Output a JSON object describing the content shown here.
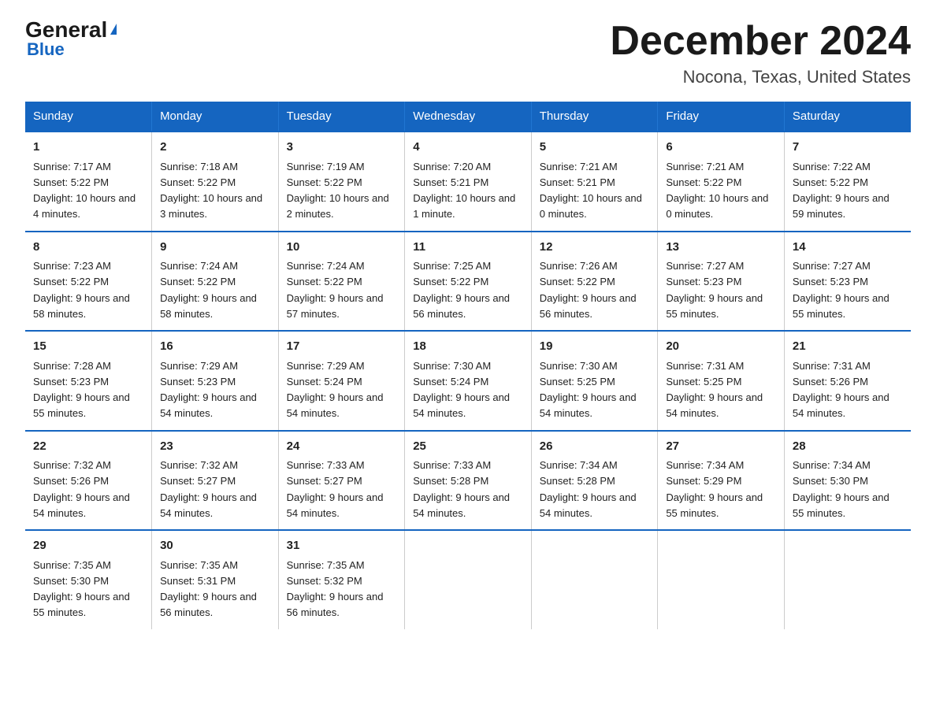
{
  "logo": {
    "general": "General",
    "triangle": "▲",
    "blue": "Blue"
  },
  "title": "December 2024",
  "subtitle": "Nocona, Texas, United States",
  "days_of_week": [
    "Sunday",
    "Monday",
    "Tuesday",
    "Wednesday",
    "Thursday",
    "Friday",
    "Saturday"
  ],
  "weeks": [
    [
      {
        "day": "1",
        "sunrise": "7:17 AM",
        "sunset": "5:22 PM",
        "daylight": "10 hours and 4 minutes."
      },
      {
        "day": "2",
        "sunrise": "7:18 AM",
        "sunset": "5:22 PM",
        "daylight": "10 hours and 3 minutes."
      },
      {
        "day": "3",
        "sunrise": "7:19 AM",
        "sunset": "5:22 PM",
        "daylight": "10 hours and 2 minutes."
      },
      {
        "day": "4",
        "sunrise": "7:20 AM",
        "sunset": "5:21 PM",
        "daylight": "10 hours and 1 minute."
      },
      {
        "day": "5",
        "sunrise": "7:21 AM",
        "sunset": "5:21 PM",
        "daylight": "10 hours and 0 minutes."
      },
      {
        "day": "6",
        "sunrise": "7:21 AM",
        "sunset": "5:22 PM",
        "daylight": "10 hours and 0 minutes."
      },
      {
        "day": "7",
        "sunrise": "7:22 AM",
        "sunset": "5:22 PM",
        "daylight": "9 hours and 59 minutes."
      }
    ],
    [
      {
        "day": "8",
        "sunrise": "7:23 AM",
        "sunset": "5:22 PM",
        "daylight": "9 hours and 58 minutes."
      },
      {
        "day": "9",
        "sunrise": "7:24 AM",
        "sunset": "5:22 PM",
        "daylight": "9 hours and 58 minutes."
      },
      {
        "day": "10",
        "sunrise": "7:24 AM",
        "sunset": "5:22 PM",
        "daylight": "9 hours and 57 minutes."
      },
      {
        "day": "11",
        "sunrise": "7:25 AM",
        "sunset": "5:22 PM",
        "daylight": "9 hours and 56 minutes."
      },
      {
        "day": "12",
        "sunrise": "7:26 AM",
        "sunset": "5:22 PM",
        "daylight": "9 hours and 56 minutes."
      },
      {
        "day": "13",
        "sunrise": "7:27 AM",
        "sunset": "5:23 PM",
        "daylight": "9 hours and 55 minutes."
      },
      {
        "day": "14",
        "sunrise": "7:27 AM",
        "sunset": "5:23 PM",
        "daylight": "9 hours and 55 minutes."
      }
    ],
    [
      {
        "day": "15",
        "sunrise": "7:28 AM",
        "sunset": "5:23 PM",
        "daylight": "9 hours and 55 minutes."
      },
      {
        "day": "16",
        "sunrise": "7:29 AM",
        "sunset": "5:23 PM",
        "daylight": "9 hours and 54 minutes."
      },
      {
        "day": "17",
        "sunrise": "7:29 AM",
        "sunset": "5:24 PM",
        "daylight": "9 hours and 54 minutes."
      },
      {
        "day": "18",
        "sunrise": "7:30 AM",
        "sunset": "5:24 PM",
        "daylight": "9 hours and 54 minutes."
      },
      {
        "day": "19",
        "sunrise": "7:30 AM",
        "sunset": "5:25 PM",
        "daylight": "9 hours and 54 minutes."
      },
      {
        "day": "20",
        "sunrise": "7:31 AM",
        "sunset": "5:25 PM",
        "daylight": "9 hours and 54 minutes."
      },
      {
        "day": "21",
        "sunrise": "7:31 AM",
        "sunset": "5:26 PM",
        "daylight": "9 hours and 54 minutes."
      }
    ],
    [
      {
        "day": "22",
        "sunrise": "7:32 AM",
        "sunset": "5:26 PM",
        "daylight": "9 hours and 54 minutes."
      },
      {
        "day": "23",
        "sunrise": "7:32 AM",
        "sunset": "5:27 PM",
        "daylight": "9 hours and 54 minutes."
      },
      {
        "day": "24",
        "sunrise": "7:33 AM",
        "sunset": "5:27 PM",
        "daylight": "9 hours and 54 minutes."
      },
      {
        "day": "25",
        "sunrise": "7:33 AM",
        "sunset": "5:28 PM",
        "daylight": "9 hours and 54 minutes."
      },
      {
        "day": "26",
        "sunrise": "7:34 AM",
        "sunset": "5:28 PM",
        "daylight": "9 hours and 54 minutes."
      },
      {
        "day": "27",
        "sunrise": "7:34 AM",
        "sunset": "5:29 PM",
        "daylight": "9 hours and 55 minutes."
      },
      {
        "day": "28",
        "sunrise": "7:34 AM",
        "sunset": "5:30 PM",
        "daylight": "9 hours and 55 minutes."
      }
    ],
    [
      {
        "day": "29",
        "sunrise": "7:35 AM",
        "sunset": "5:30 PM",
        "daylight": "9 hours and 55 minutes."
      },
      {
        "day": "30",
        "sunrise": "7:35 AM",
        "sunset": "5:31 PM",
        "daylight": "9 hours and 56 minutes."
      },
      {
        "day": "31",
        "sunrise": "7:35 AM",
        "sunset": "5:32 PM",
        "daylight": "9 hours and 56 minutes."
      },
      null,
      null,
      null,
      null
    ]
  ],
  "labels": {
    "sunrise": "Sunrise:",
    "sunset": "Sunset:",
    "daylight": "Daylight:"
  }
}
